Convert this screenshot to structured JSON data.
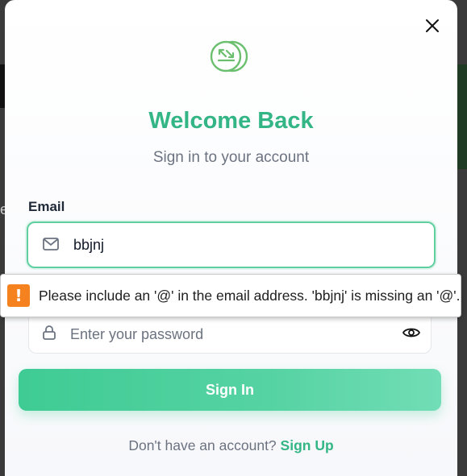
{
  "modal": {
    "title": "Welcome Back",
    "subtitle": "Sign in to your account"
  },
  "email": {
    "label": "Email",
    "value": "bbjnj",
    "icon": "mail-icon"
  },
  "password": {
    "placeholder": "Enter your password",
    "icon": "lock-icon",
    "toggle_icon": "eye-icon"
  },
  "validation_tooltip": {
    "icon": "warning-icon",
    "message": "Please include an '@' in the email address. 'bbjnj' is missing an '@'."
  },
  "submit": {
    "label": "Sign In"
  },
  "footer": {
    "prompt": "Don't have an account?",
    "link": "Sign Up"
  },
  "background": {
    "letter": "e"
  },
  "colors": {
    "brand": "#34b585",
    "button_start": "#3fcb94",
    "button_end": "#72ddb6",
    "warning": "#f5811f"
  }
}
